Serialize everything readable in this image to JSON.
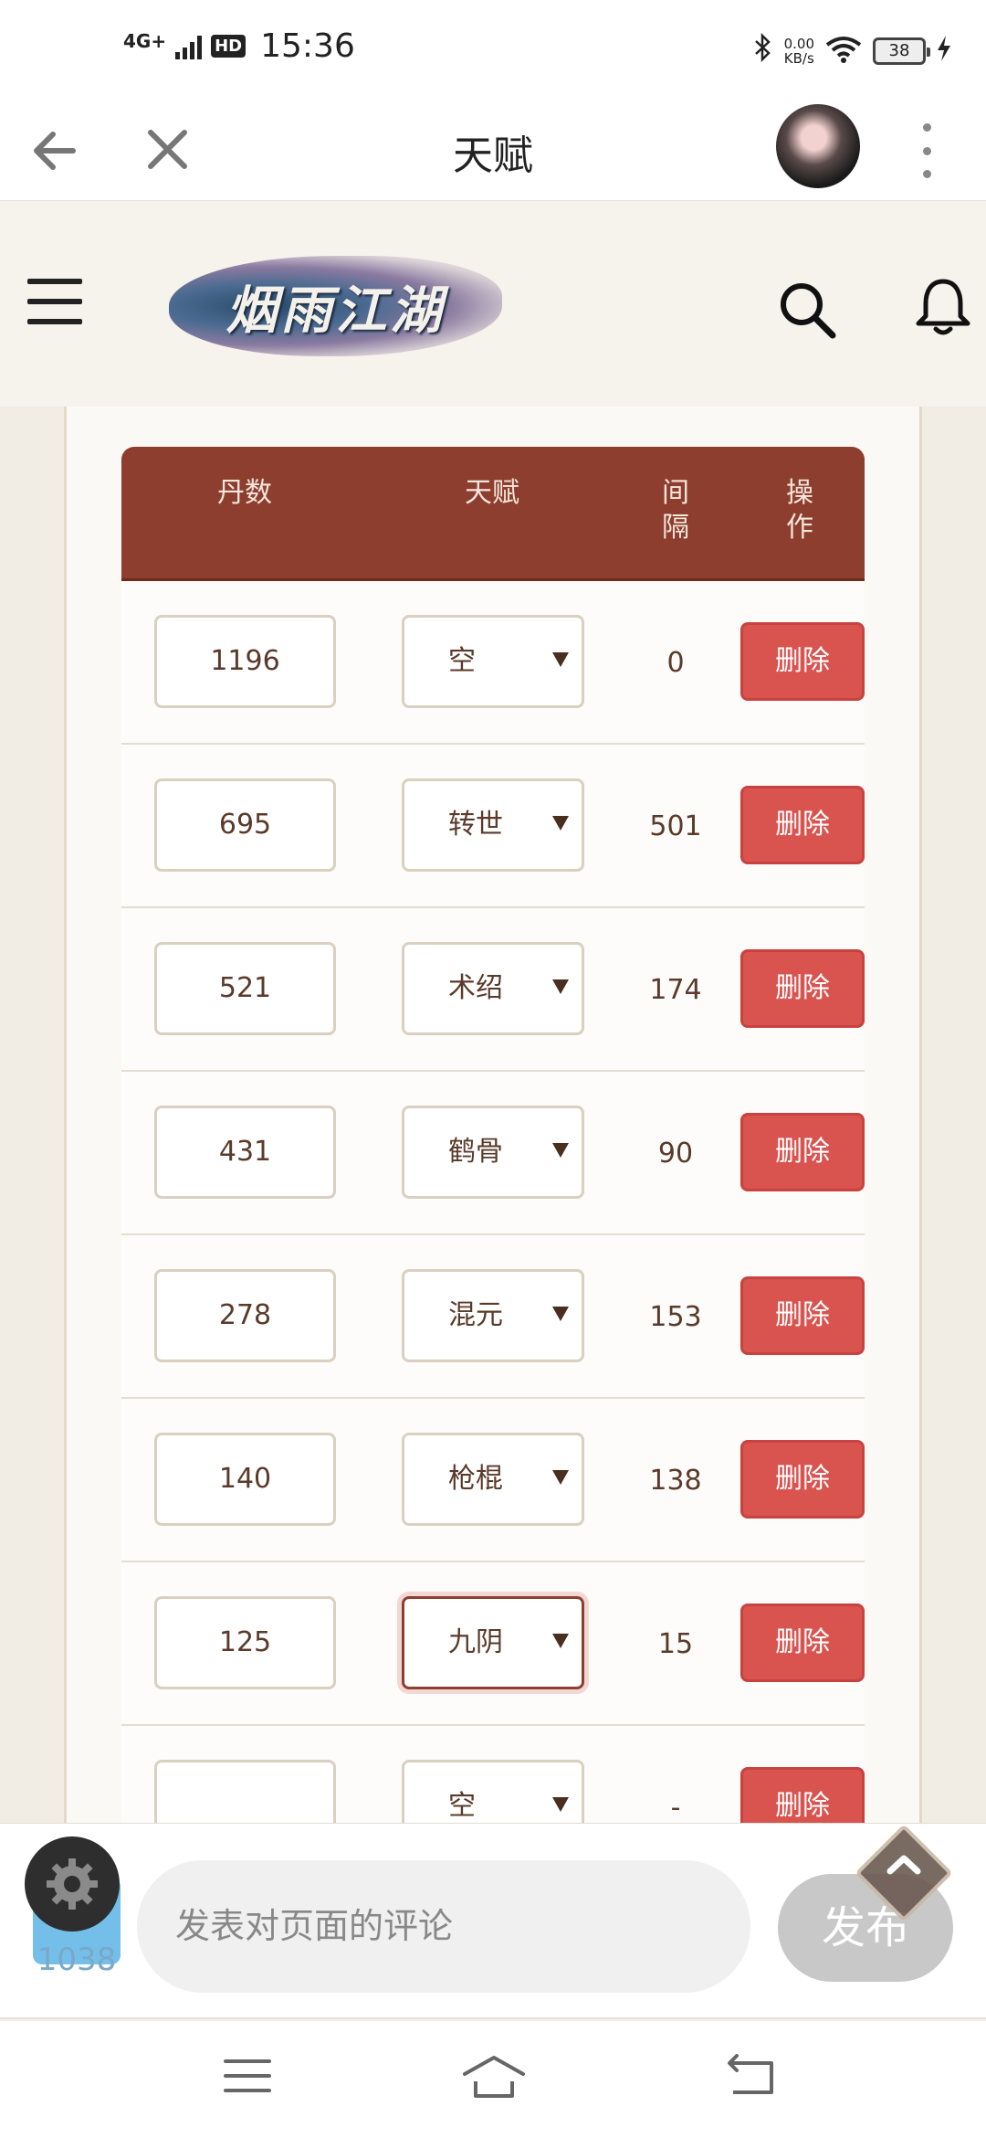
{
  "status_bar": {
    "network": "4G+",
    "hd": "HD",
    "time": "15:36",
    "speed_value": "0.00",
    "speed_unit": "KB/s",
    "battery": "38"
  },
  "title_bar": {
    "title": "天赋"
  },
  "site": {
    "logo_text": "烟雨江湖"
  },
  "table": {
    "headers": {
      "dan": "丹数",
      "talent": "天赋",
      "gap": "间\n隔",
      "op": "操\n作"
    },
    "rows": [
      {
        "dan": "1196",
        "talent": "空",
        "gap": "0",
        "action": "删除"
      },
      {
        "dan": "695",
        "talent": "转世",
        "gap": "501",
        "action": "删除"
      },
      {
        "dan": "521",
        "talent": "术绍",
        "gap": "174",
        "action": "删除"
      },
      {
        "dan": "431",
        "talent": "鹤骨",
        "gap": "90",
        "action": "删除"
      },
      {
        "dan": "278",
        "talent": "混元",
        "gap": "153",
        "action": "删除"
      },
      {
        "dan": "140",
        "talent": "枪棍",
        "gap": "138",
        "action": "删除"
      },
      {
        "dan": "125",
        "talent": "九阴",
        "gap": "15",
        "action": "删除"
      },
      {
        "dan": "",
        "talent": "空",
        "gap": "-",
        "action": "删除"
      }
    ]
  },
  "comment": {
    "placeholder": "发表对页面的评论",
    "post_label": "发布",
    "badge_count": "1038"
  },
  "colors": {
    "header_bg": "#8e3e2f",
    "delete_bg": "#d9534f",
    "page_bg": "#f4f0e8"
  }
}
